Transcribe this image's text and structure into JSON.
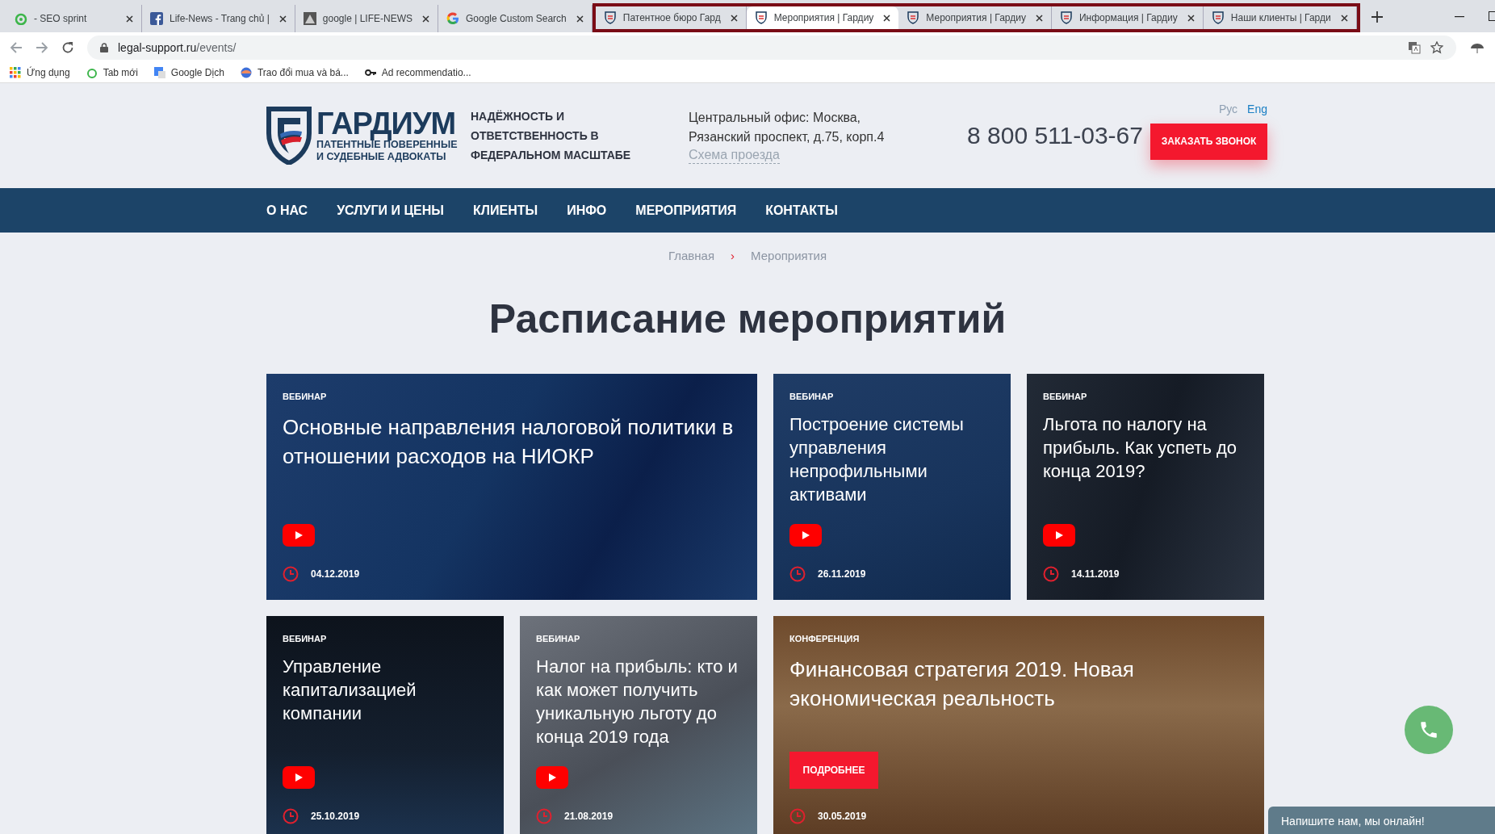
{
  "browser": {
    "tabs": [
      {
        "title": "- SEO sprint",
        "kind": "seo",
        "selected": false,
        "highlighted": false
      },
      {
        "title": "Life-News - Trang chủ |",
        "kind": "facebook",
        "selected": false,
        "highlighted": false
      },
      {
        "title": "google | LIFE-NEWS",
        "kind": "image",
        "selected": false,
        "highlighted": false
      },
      {
        "title": "Google Custom Search",
        "kind": "google",
        "selected": false,
        "highlighted": false
      },
      {
        "title": "Патентное бюро Гард",
        "kind": "shield",
        "selected": false,
        "highlighted": true
      },
      {
        "title": "Мероприятия | Гардиу",
        "kind": "shield",
        "selected": true,
        "highlighted": true
      },
      {
        "title": "Мероприятия | Гардиу",
        "kind": "shield",
        "selected": false,
        "highlighted": true
      },
      {
        "title": "Информация | Гардиу",
        "kind": "shield",
        "selected": false,
        "highlighted": true
      },
      {
        "title": "Наши клиенты | Гарди",
        "kind": "shield",
        "selected": false,
        "highlighted": true
      }
    ],
    "url_host": "legal-support.ru",
    "url_path": "/events/",
    "bookmarks": [
      {
        "label": "Ứng dụng",
        "kind": "apps"
      },
      {
        "label": "Tab mới",
        "kind": "seo"
      },
      {
        "label": "Google Dịch",
        "kind": "translate"
      },
      {
        "label": "Trao đổi mua và bá...",
        "kind": "globe"
      },
      {
        "label": "Ad recommendatio...",
        "kind": "key"
      }
    ]
  },
  "header": {
    "logo_name": "ГАРДИУМ",
    "logo_sub": [
      "ПАТЕНТНЫЕ ПОВЕРЕННЫЕ",
      "И СУДЕБНЫЕ АДВОКАТЫ"
    ],
    "tagline": [
      "НАДЁЖНОСТЬ И",
      "ОТВЕТСТВЕННОСТЬ В",
      "ФЕДЕРАЛЬНОМ МАСШТАБЕ"
    ],
    "address": [
      "Центральный офис: Москва,",
      "Рязанский проспект, д.75, корп.4"
    ],
    "map_link": "Схема проезда",
    "phone": "8 800 511-03-67",
    "languages": [
      {
        "label": "Рус",
        "selected": true
      },
      {
        "label": "Eng",
        "selected": false
      }
    ],
    "callback_button": "ЗАКАЗАТЬ ЗВОНОК"
  },
  "nav": [
    "О НАС",
    "УСЛУГИ И ЦЕНЫ",
    "КЛИЕНТЫ",
    "ИНФО",
    "МЕРОПРИЯТИЯ",
    "КОНТАКТЫ"
  ],
  "breadcrumb": {
    "home": "Главная",
    "separator": "›",
    "current": "Мероприятия"
  },
  "title": "Расписание мероприятий",
  "events": [
    {
      "kind": "chevrons",
      "wide": true,
      "tag": "ВЕБИНАР",
      "title": "Основные направления налоговой политики в отношении расходов на НИОКР",
      "date": "04.12.2019"
    },
    {
      "kind": "blocks",
      "wide": false,
      "tag": "ВЕБИНАР",
      "title": "Построение системы управления непрофильными активами",
      "date": "26.11.2019"
    },
    {
      "kind": "glass",
      "wide": false,
      "tag": "ВЕБИНАР",
      "title": "Льгота по налогу на прибыль. Как успеть до конца 2019?",
      "date": "14.11.2019"
    },
    {
      "kind": "grid",
      "wide": false,
      "tag": "ВЕБИНАР",
      "title": "Управление капитализацией компании",
      "date": "25.10.2019"
    },
    {
      "kind": "paper",
      "wide": false,
      "tag": "ВЕБИНАР",
      "title": "Налог на прибыль: кто и как может получить уникальную льготу до конца 2019 года",
      "date": "21.08.2019"
    },
    {
      "kind": "photo",
      "wide": true,
      "tag": "КОНФЕРЕНЦИЯ",
      "title": "Финансовая стратегия 2019. Новая экономическая реальность",
      "date": "30.05.2019",
      "more_button": "ПОДРОБНЕЕ"
    }
  ],
  "chat_bar": "Напишите нам, мы онлайн!"
}
